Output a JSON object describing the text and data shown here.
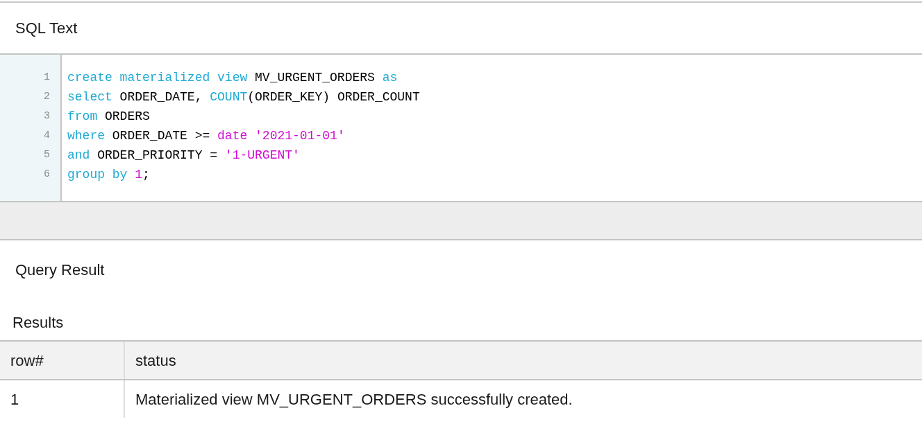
{
  "sql_panel": {
    "title": "SQL Text",
    "lines": [
      {
        "number": "1",
        "tokens": [
          {
            "kind": "keyword",
            "text": "create materialized view"
          },
          {
            "kind": "plain",
            "text": " MV_URGENT_ORDERS "
          },
          {
            "kind": "keyword",
            "text": "as"
          }
        ]
      },
      {
        "number": "2",
        "tokens": [
          {
            "kind": "keyword",
            "text": "select"
          },
          {
            "kind": "plain",
            "text": " ORDER_DATE, "
          },
          {
            "kind": "keyword",
            "text": "COUNT"
          },
          {
            "kind": "plain",
            "text": "(ORDER_KEY) ORDER_COUNT"
          }
        ]
      },
      {
        "number": "3",
        "tokens": [
          {
            "kind": "keyword",
            "text": "from"
          },
          {
            "kind": "plain",
            "text": " ORDERS"
          }
        ]
      },
      {
        "number": "4",
        "tokens": [
          {
            "kind": "keyword",
            "text": "where"
          },
          {
            "kind": "plain",
            "text": " ORDER_DATE >= "
          },
          {
            "kind": "literal",
            "text": "date '2021-01-01'"
          }
        ]
      },
      {
        "number": "5",
        "tokens": [
          {
            "kind": "keyword",
            "text": "and"
          },
          {
            "kind": "plain",
            "text": " ORDER_PRIORITY = "
          },
          {
            "kind": "literal",
            "text": "'1-URGENT'"
          }
        ]
      },
      {
        "number": "6",
        "tokens": [
          {
            "kind": "keyword",
            "text": "group by "
          },
          {
            "kind": "literal",
            "text": "1"
          },
          {
            "kind": "plain",
            "text": ";"
          }
        ]
      }
    ]
  },
  "result_panel": {
    "title": "Query Result",
    "subtitle": "Results",
    "table": {
      "columns": [
        "row#",
        "status"
      ],
      "rows": [
        [
          "1",
          "Materialized view MV_URGENT_ORDERS successfully created."
        ]
      ]
    }
  }
}
